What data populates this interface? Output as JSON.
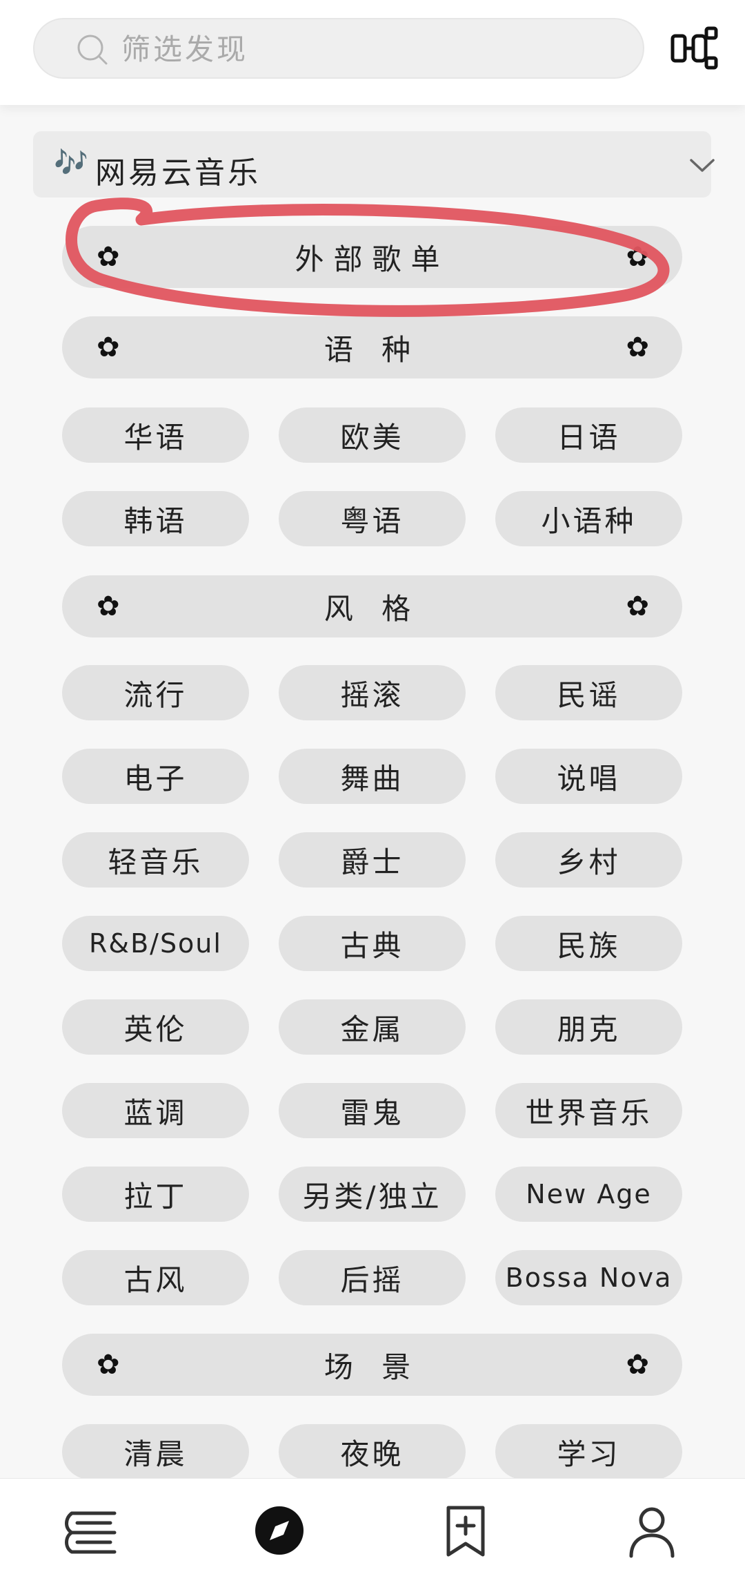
{
  "search": {
    "placeholder": "筛选发现"
  },
  "header": {
    "scan_icon": "scan-icon"
  },
  "source": {
    "notes": "🎶",
    "label": "网易云音乐",
    "chevron_icon": "chevron-down-icon"
  },
  "external": {
    "label": "外部歌单",
    "flower": "✿"
  },
  "sections": [
    {
      "title": "语 种",
      "flower": "✿",
      "items": [
        "华语",
        "欧美",
        "日语",
        "韩语",
        "粤语",
        "小语种"
      ]
    },
    {
      "title": "风 格",
      "flower": "✿",
      "items": [
        "流行",
        "摇滚",
        "民谣",
        "电子",
        "舞曲",
        "说唱",
        "轻音乐",
        "爵士",
        "乡村",
        "R&B/Soul",
        "古典",
        "民族",
        "英伦",
        "金属",
        "朋克",
        "蓝调",
        "雷鬼",
        "世界音乐",
        "拉丁",
        "另类/独立",
        "New Age",
        "古风",
        "后摇",
        "Bossa Nova"
      ]
    },
    {
      "title": "场 景",
      "flower": "✿",
      "items": [
        "清晨",
        "夜晚",
        "学习"
      ]
    }
  ],
  "bottom_nav": [
    {
      "name": "library-icon",
      "active": false
    },
    {
      "name": "compass-icon",
      "active": true
    },
    {
      "name": "bookmark-add-icon",
      "active": false
    },
    {
      "name": "profile-icon",
      "active": false
    }
  ],
  "colors": {
    "pill": "#e2e2e2",
    "annotation": "#e0555f",
    "text": "#222222"
  }
}
